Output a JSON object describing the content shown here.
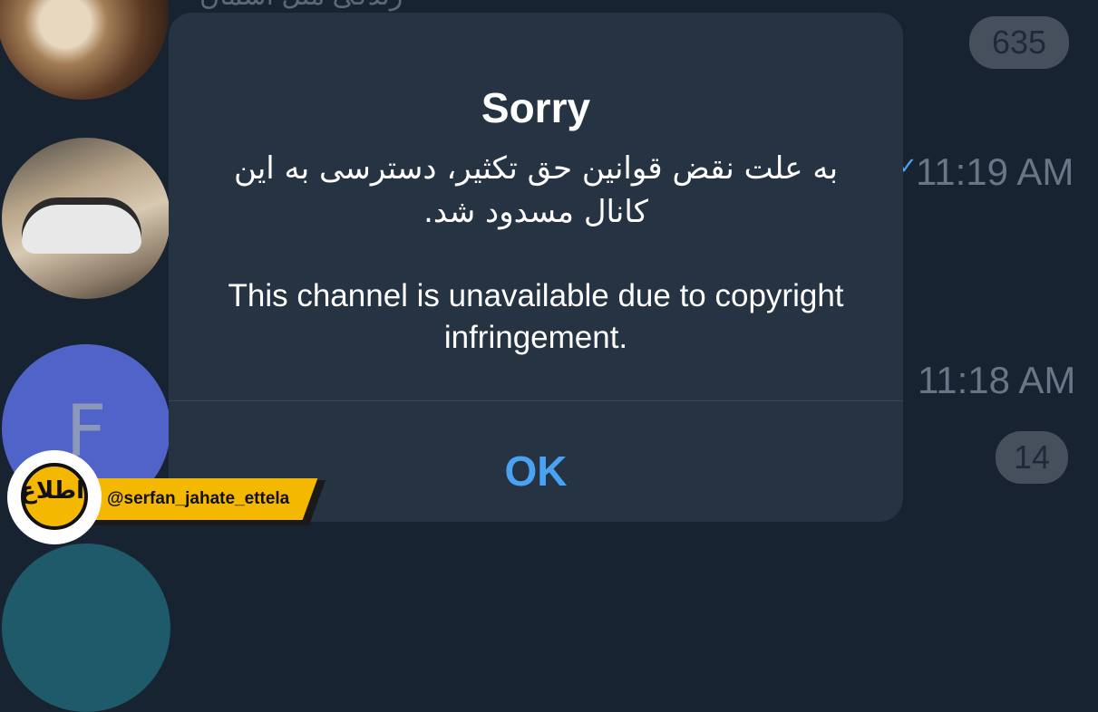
{
  "background": {
    "top_snippet": "زندگی مثل آسمان",
    "badges": {
      "top": "635",
      "bottom": "14"
    },
    "times": {
      "first": "11:19 AM",
      "second": "11:18 AM"
    },
    "avatar_letter": "F"
  },
  "dialog": {
    "title": "Sorry",
    "message_fa": "به علت نقض قوانین حق تکثیر، دسترسی به این کانال مسدود شد.",
    "message_en": "This channel is unavailable due to copyright infringement.",
    "ok_label": "OK"
  },
  "watermark": {
    "handle": "@serfan_jahate_ettela",
    "logo_text": "اطلاع"
  },
  "colors": {
    "background": "#172330",
    "dialog": "#263343",
    "accent": "#4aa3f2",
    "watermark_yellow": "#f5b800"
  }
}
